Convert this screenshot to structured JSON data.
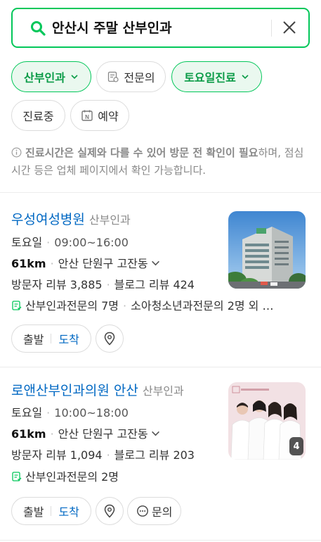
{
  "search": {
    "query": "안산시 주말 산부인과"
  },
  "filters": [
    {
      "label": "산부인과",
      "active": true,
      "dropdown": true
    },
    {
      "label": "전문의",
      "active": false,
      "icon": "doctor-doc-icon"
    },
    {
      "label": "토요일진료",
      "active": true,
      "dropdown": true
    },
    {
      "label": "진료중",
      "active": false
    },
    {
      "label": "예약",
      "active": false,
      "icon": "naver-booking-icon"
    }
  ],
  "notice": {
    "bold": "진료시간은 실제와 다를 수 있어 방문 전 확인이 필요",
    "rest": "하며, 점심시간 등은 업체 페이지에서 확인 가능합니다."
  },
  "results": [
    {
      "name": "우성여성병원",
      "category": "산부인과",
      "day": "토요일",
      "hours": "09:00~16:00",
      "distance": "61km",
      "address": "안산 단원구 고잔동",
      "visitor_reviews": "방문자 리뷰 3,885",
      "blog_reviews": "블로그 리뷰 424",
      "specialists": "산부인과전문의 7명",
      "specialists_extra": "소아청소년과전문의 2명 외 …",
      "depart_label": "출발",
      "arrive_label": "도착"
    },
    {
      "name": "로앤산부인과의원 안산",
      "category": "산부인과",
      "day": "토요일",
      "hours": "10:00~18:00",
      "distance": "61km",
      "address": "안산 단원구 고잔동",
      "visitor_reviews": "방문자 리뷰 1,094",
      "blog_reviews": "블로그 리뷰 203",
      "specialists": "산부인과전문의 2명",
      "depart_label": "출발",
      "arrive_label": "도착",
      "inquiry_label": "문의",
      "photo_count": "4"
    }
  ],
  "colors": {
    "accent": "#03c75a",
    "accent_text": "#0a9b47",
    "link": "#0068c3"
  }
}
